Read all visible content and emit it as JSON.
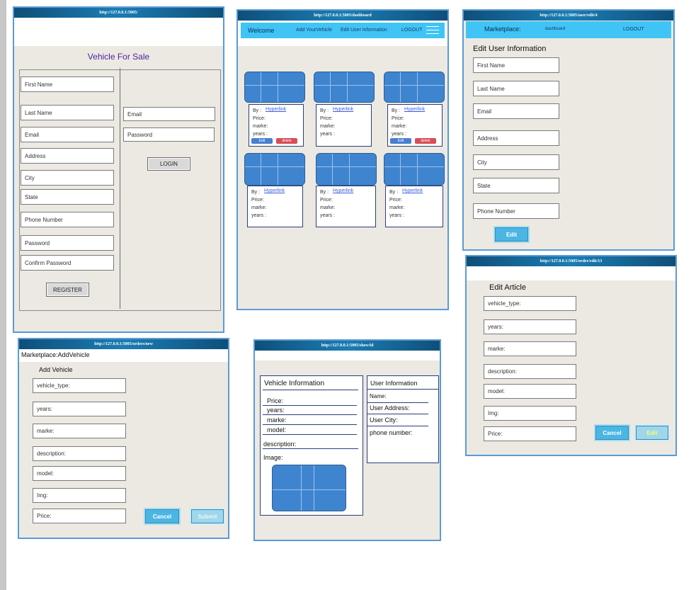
{
  "register_page": {
    "url": "http://127.0.0.1:5005/",
    "title": "Vehicle For Sale",
    "fields": [
      "First Name",
      "Last Name",
      "Email",
      "Address",
      "City",
      "State",
      "Phone Number",
      "Password",
      "Confirm Password"
    ],
    "register_label": "REGISTER",
    "login_fields": [
      "Email",
      "Password"
    ],
    "login_label": "LOGIN"
  },
  "dashboard_page": {
    "url": "http://127.0.0.1:5005/dashboard",
    "nav": {
      "welcome": "Welcome",
      "add_vehicle": "Add YourVehicle",
      "edit_user": "Edit User Information",
      "logout": "LOGOUT"
    },
    "card": {
      "by": "By :",
      "link": "Hyperlink",
      "price": "Price:",
      "marke": "marke:",
      "years": "years :",
      "edit": "Edit",
      "delete": "delete"
    }
  },
  "edit_user_page": {
    "url": "http://127.0.0.1:5005/user/edit/4",
    "nav": {
      "brand": "Marketplace:",
      "dashboard": "dashboard",
      "logout": "LOGOUT"
    },
    "heading": "Edit User Information",
    "fields": [
      "First Name",
      "Last Name",
      "Email",
      "Address",
      "City",
      "State",
      "Phone Number"
    ],
    "edit_label": "Edit"
  },
  "edit_article_page": {
    "url": "http://127.0.0.1:5005/order/edit/13",
    "heading": "Edit Article",
    "fields": [
      "vehicle_type:",
      "years:",
      "marke:",
      "description:",
      "model:",
      "Img:",
      "Price:"
    ],
    "cancel_label": "Cancel",
    "edit_label": "Edit"
  },
  "add_vehicle_page": {
    "url": "http://127.0.0.1:5005/orders/new",
    "brand": "Marketplace:AddVehicle",
    "heading": "Add Vehicle",
    "fields": [
      "vehicle_type:",
      "years:",
      "marke:",
      "description:",
      "model:",
      "Img:",
      "Price:"
    ],
    "cancel_label": "Cancel",
    "submit_label": "Submit"
  },
  "show_page": {
    "url": "http://127.0.0.1:5005/show/id",
    "vehicle_title": "Vehicle Information",
    "vehicle_fields": [
      "Price:",
      "years:",
      "marke:",
      "model:",
      "description:",
      "Image:"
    ],
    "user_title": "User Information",
    "user_fields": [
      "Name:",
      "User Address:",
      "User City:",
      "phone number:"
    ]
  },
  "colors": {
    "accent": "#4bb6e2",
    "frame": "#5b9bd5",
    "titlebar": "#1b7db3",
    "panel": "#ece9e2",
    "image": "#3f84cf"
  }
}
